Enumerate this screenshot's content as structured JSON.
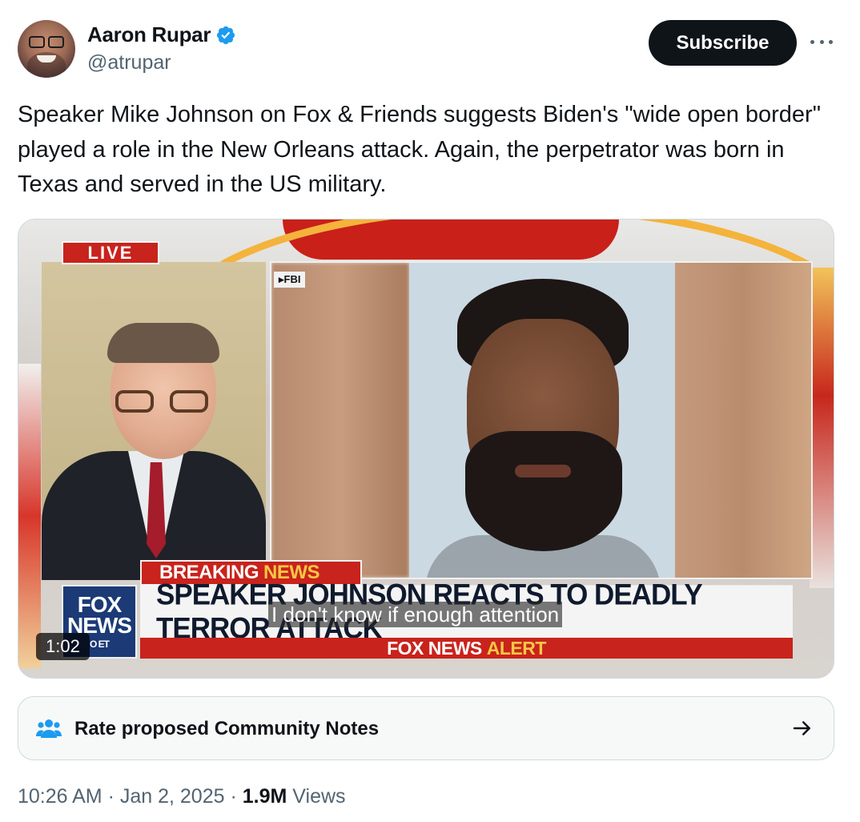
{
  "author": {
    "name": "Aaron Rupar",
    "handle": "@atrupar",
    "verified_color": "#1d9bf0"
  },
  "header": {
    "subscribe_label": "Subscribe",
    "more_icon": "more-horizontal-icon"
  },
  "tweet": {
    "text": "Speaker Mike Johnson on Fox & Friends suggests Biden's \"wide open border\" played a role in the New Orleans attack. Again, the perpetrator was born in Texas and served in the US military."
  },
  "video": {
    "live_label": "LIVE",
    "fbi_label": "▸FBI",
    "breaking_label": "BREAKING",
    "news_label": "NEWS",
    "headline": "SPEAKER JOHNSON REACTS TO DEADLY TERROR ATTACK",
    "caption": "I don't know if enough attention",
    "alert_prefix": "FOX NEWS",
    "alert_suffix": "ALERT",
    "logo_line1": "FOX",
    "logo_line2": "NEWS",
    "logo_line3": "O ET",
    "duration": "1:02",
    "colors": {
      "fox_red": "#c8231c",
      "fox_blue": "#1b3a76",
      "fox_yellow": "#f7c744"
    }
  },
  "community_notes": {
    "label": "Rate proposed Community Notes",
    "icon": "people-icon",
    "arrow_icon": "arrow-right-icon",
    "icon_color": "#1d9bf0"
  },
  "meta": {
    "time": "10:26 AM",
    "sep1": " · ",
    "date": "Jan 2, 2025",
    "sep2": " · ",
    "views_count": "1.9M",
    "views_label": " Views"
  }
}
